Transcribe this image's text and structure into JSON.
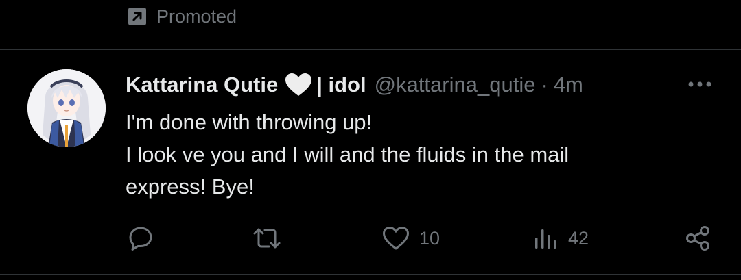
{
  "promoted": {
    "label": "Promoted",
    "icon": "promoted-arrow-icon"
  },
  "tweet": {
    "author": {
      "name": "Kattarina Qutie",
      "emoji": "white-heart",
      "name_suffix": "| idol",
      "handle": "@kattarina_qutie",
      "separator": "·",
      "time": "4m"
    },
    "text_lines": [
      "I'm done with throwing up!",
      "I look ve you and I will and the fluids in the mail",
      "express! Bye!"
    ],
    "actions": {
      "reply_count": "",
      "retweet_count": "",
      "like_count": "10",
      "views_count": "42"
    }
  },
  "colors": {
    "background": "#000000",
    "text": "#e7e9ea",
    "muted": "#71767b",
    "divider": "#2f3336"
  }
}
